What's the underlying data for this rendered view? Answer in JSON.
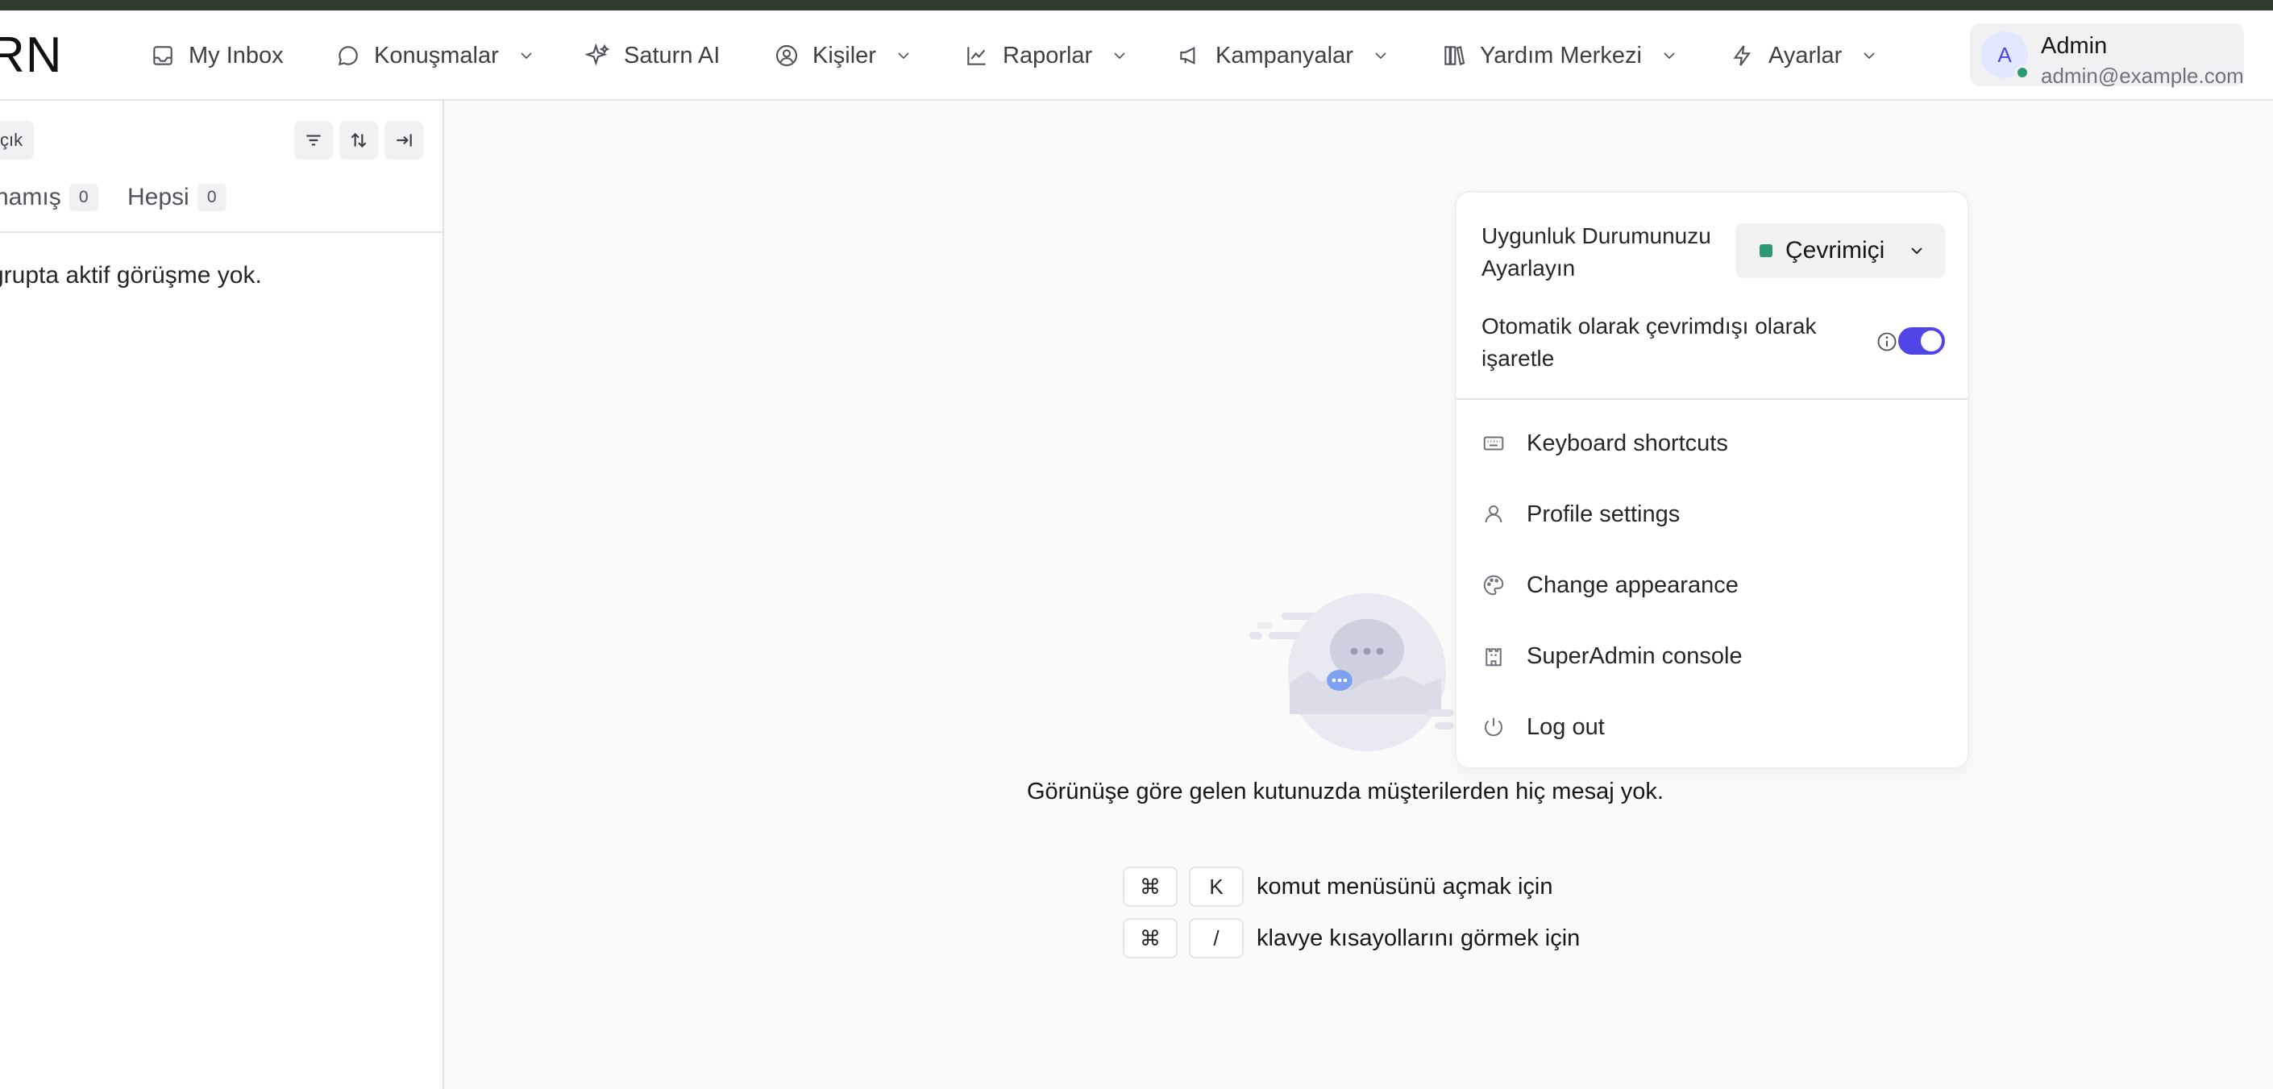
{
  "app": {
    "logo_text": "RN"
  },
  "nav": {
    "items": [
      {
        "label": "My Inbox",
        "icon": "inbox-icon",
        "dropdown": false
      },
      {
        "label": "Konuşmalar",
        "icon": "chat-bubble-icon",
        "dropdown": true
      },
      {
        "label": "Saturn AI",
        "icon": "sparkles-icon",
        "dropdown": false
      },
      {
        "label": "Kişiler",
        "icon": "contact-icon",
        "dropdown": true
      },
      {
        "label": "Raporlar",
        "icon": "line-chart-icon",
        "dropdown": true
      },
      {
        "label": "Kampanyalar",
        "icon": "megaphone-icon",
        "dropdown": true
      },
      {
        "label": "Yardım Merkezi",
        "icon": "library-icon",
        "dropdown": true
      },
      {
        "label": "Ayarlar",
        "icon": "bolt-icon",
        "dropdown": true
      }
    ]
  },
  "profile": {
    "avatar_initial": "A",
    "name": "Admin",
    "email": "admin@example.com",
    "status_color": "#2b9a73"
  },
  "conversation_list": {
    "filter_chip": "çık",
    "tabs": [
      {
        "label": "namış",
        "count": "0"
      },
      {
        "label": "Hepsi",
        "count": "0"
      }
    ],
    "empty_text": "grupta aktif görüşme yok."
  },
  "main": {
    "empty_message": "Görünüşe göre gelen kutunuzda müşterilerden hiç mesaj yok.",
    "shortcuts": [
      {
        "keys": [
          "⌘",
          "K"
        ],
        "text": "komut menüsünü açmak için"
      },
      {
        "keys": [
          "⌘",
          "/"
        ],
        "text": "klavye kısayollarını görmek için"
      }
    ]
  },
  "profile_menu": {
    "availability_label": "Uygunluk Durumunuzu Ayarlayın",
    "availability_value": "Çevrimiçi",
    "auto_offline_label": "Otomatik olarak çevrimdışı olarak işaretle",
    "auto_offline_enabled": true,
    "items": [
      {
        "label": "Keyboard shortcuts",
        "icon": "keyboard-icon"
      },
      {
        "label": "Profile settings",
        "icon": "user-icon"
      },
      {
        "label": "Change appearance",
        "icon": "palette-icon"
      },
      {
        "label": "SuperAdmin console",
        "icon": "castle-icon"
      },
      {
        "label": "Log out",
        "icon": "power-icon"
      }
    ]
  },
  "colors": {
    "accent": "#4f46e5",
    "online": "#2b9a73",
    "topstrip": "#2f3b2c"
  }
}
